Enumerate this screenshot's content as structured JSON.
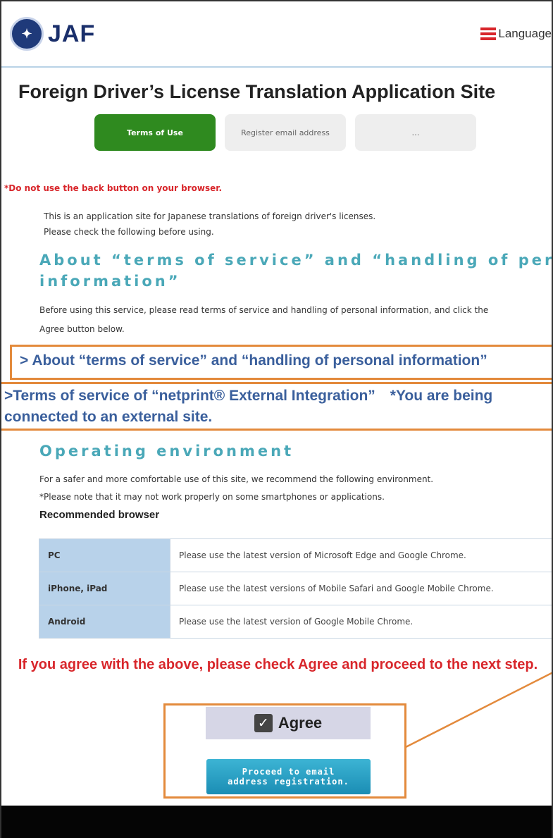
{
  "header": {
    "logo_text": "JAF",
    "language_label": "Language"
  },
  "title": "Foreign Driver’s License Translation Application Site",
  "steps": [
    {
      "label": "Terms of Use",
      "active": true
    },
    {
      "label": "Register email address",
      "active": false
    },
    {
      "label": "…",
      "active": false
    }
  ],
  "warning": "*Do not use the back button on your browser.",
  "intro": {
    "line1": "This is an application site for Japanese translations of foreign driver's licenses.",
    "line2": "Please check the following before using."
  },
  "about_section": {
    "heading_line1": "About “terms of service” and “handling of personal",
    "heading_line2": "information”",
    "paragraph_line1": "Before using this service, please read terms of service and handling of personal information, and click the",
    "paragraph_line2": "Agree button below."
  },
  "links": {
    "terms_link": "> About “terms of service” and “handling of personal information”",
    "netprint_link": ">Terms of service of “netprint® External Integration”　*You are being connected to an external site."
  },
  "environment": {
    "heading": "Operating environment",
    "paragraph_line1": "For a safer and more comfortable use of this site, we recommend the following environment.",
    "paragraph_line2": "*Please note that it may not work properly on some smartphones or applications.",
    "recommended_browser": "Recommended browser",
    "rows": [
      {
        "platform": "PC",
        "note": "Please use the latest version of Microsoft Edge and Google Chrome."
      },
      {
        "platform": "iPhone, iPad",
        "note": "Please use the latest versions of Mobile Safari and Google Mobile Chrome."
      },
      {
        "platform": "Android",
        "note": "Please use the latest version of Google Mobile Chrome."
      }
    ]
  },
  "agree_message": "If you agree with the above, please check Agree and proceed to the next step.",
  "agree": {
    "label": "Agree",
    "checked": true
  },
  "proceed_button": {
    "line1": "Proceed to email",
    "line2": "address registration."
  },
  "colors": {
    "accent_green": "#2f8a1f",
    "heading_teal": "#4aa8b8",
    "link_blue": "#3a5f9c",
    "warning_red": "#d8262b",
    "highlight_orange": "#e38a3c",
    "button_blue": "#1b8db4"
  }
}
